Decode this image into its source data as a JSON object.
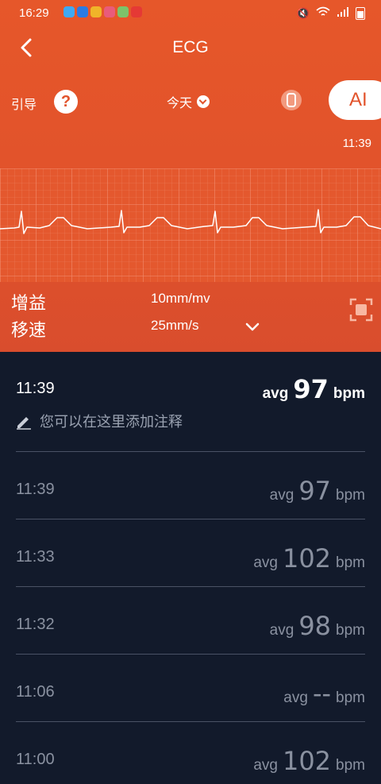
{
  "status_bar": {
    "time": "16:29",
    "app_icon_colors": [
      "#3fa9f5",
      "#2b7be4",
      "#f0b429",
      "#e95b7b",
      "#7cc36a",
      "#e53935"
    ]
  },
  "topbar": {
    "title": "ECG",
    "back_icon": "chevron-left-icon"
  },
  "controls": {
    "guide_label": "引导",
    "help_symbol": "?",
    "date_label": "今天",
    "ai_label": "AI"
  },
  "ecg": {
    "time": "11:39"
  },
  "params": {
    "gain_label": "增益",
    "gain_value": "10mm/mv",
    "speed_label": "移速",
    "speed_value": "25mm/s"
  },
  "records": {
    "first": {
      "time": "11:39",
      "avg": "avg",
      "bpm": "97",
      "unit": "bpm",
      "note_placeholder": "您可以在这里添加注释"
    },
    "items": [
      {
        "time": "11:39",
        "avg": "avg",
        "bpm": "97",
        "unit": "bpm"
      },
      {
        "time": "11:33",
        "avg": "avg",
        "bpm": "102",
        "unit": "bpm"
      },
      {
        "time": "11:32",
        "avg": "avg",
        "bpm": "98",
        "unit": "bpm"
      },
      {
        "time": "11:06",
        "avg": "avg",
        "bpm": "--",
        "unit": "bpm"
      },
      {
        "time": "11:00",
        "avg": "avg",
        "bpm": "102",
        "unit": "bpm"
      }
    ]
  },
  "colors": {
    "header_orange": "#e2532b",
    "list_background": "#121a2b",
    "muted_text": "#8a91a0"
  }
}
